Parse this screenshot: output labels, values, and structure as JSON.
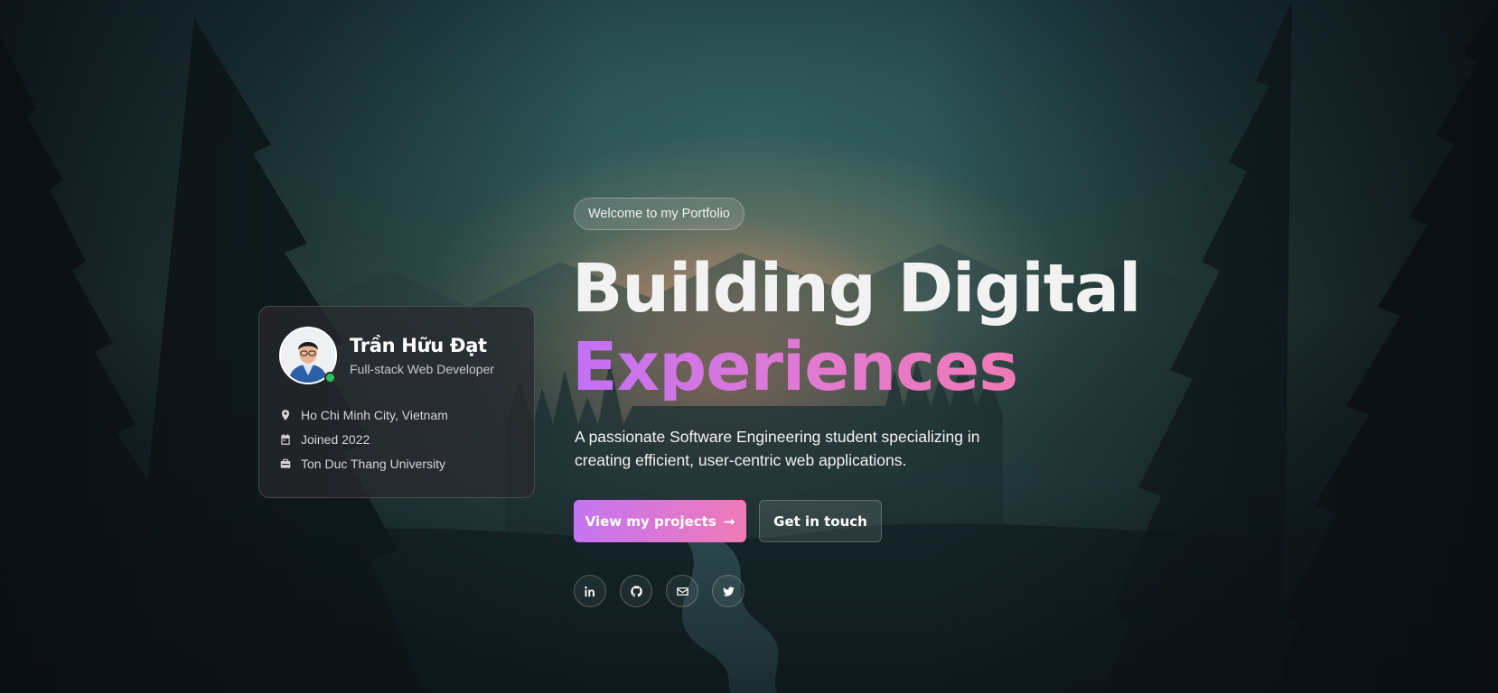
{
  "profile": {
    "name": "Trần Hữu Đạt",
    "role": "Full-stack Web Developer",
    "status": "online",
    "location": "Ho Chi Minh City, Vietnam",
    "joined": "Joined 2022",
    "school": "Ton Duc Thang University"
  },
  "hero": {
    "badge": "Welcome to my Portfolio",
    "headline_line1": "Building Digital",
    "headline_line2": "Experiences",
    "tagline_line1": "A passionate Software Engineering student specializing in",
    "tagline_line2": "creating efficient, user-centric web applications.",
    "primary_button": "View my projects",
    "secondary_button": "Get in touch"
  },
  "socials": [
    {
      "icon": "linkedin-icon"
    },
    {
      "icon": "github-icon"
    },
    {
      "icon": "mail-icon"
    },
    {
      "icon": "twitter-icon"
    }
  ],
  "colors": {
    "accent_start": "#c474f2",
    "accent_end": "#f07ab6",
    "status_online": "#22c55e"
  }
}
